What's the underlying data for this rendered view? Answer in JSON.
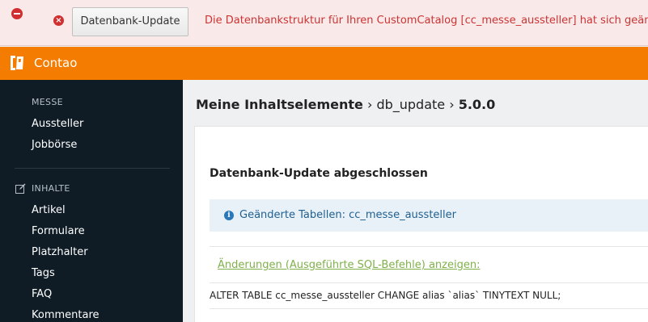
{
  "error_bar": {
    "button_label": "Datenbank-Update",
    "message": "Die Datenbankstruktur für Ihren CustomCatalog [cc_messe_aussteller] hat sich geändert -"
  },
  "header": {
    "brand": "Contao"
  },
  "sidebar": {
    "groups": [
      {
        "label": "MESSE",
        "items": [
          "Aussteller",
          "Jobbörse"
        ]
      },
      {
        "label": "INHALTE",
        "items": [
          "Artikel",
          "Formulare",
          "Platzhalter",
          "Tags",
          "FAQ",
          "Kommentare"
        ]
      }
    ]
  },
  "main": {
    "breadcrumb": [
      "Meine Inhaltselemente",
      "db_update",
      "5.0.0"
    ],
    "panel_title": "Datenbank-Update abgeschlossen",
    "info_text": "Geänderte Tabellen: cc_messe_aussteller",
    "sql_toggle": "Änderungen (Ausgeführte SQL-Befehle) anzeigen:",
    "sql_statement": "ALTER TABLE cc_messe_aussteller CHANGE alias `alias` TINYTEXT NULL;"
  },
  "colors": {
    "header": "#f47c00",
    "sidebar": "#0f1c26",
    "error_text": "#cc3333",
    "info_bg": "#e9f1f8",
    "link_green": "#7fb04a"
  }
}
